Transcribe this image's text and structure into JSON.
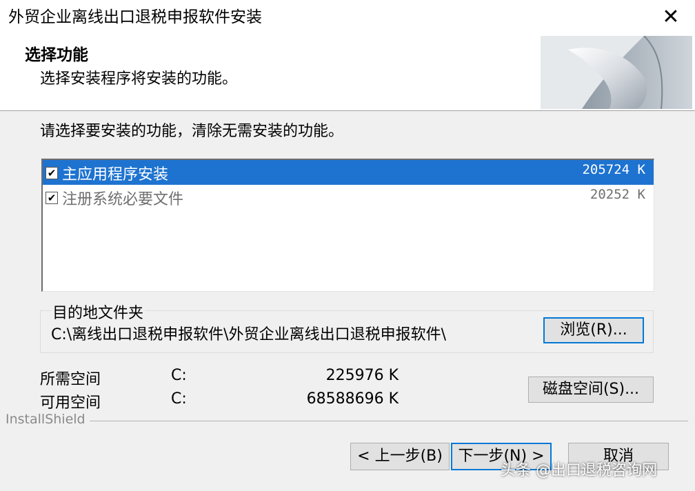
{
  "window": {
    "title": "外贸企业离线出口退税申报软件安装",
    "close_glyph": "✕"
  },
  "header": {
    "title": "选择功能",
    "subtitle": "选择安装程序将安装的功能。"
  },
  "instruction": "请选择要安装的功能，清除无需安装的功能。",
  "features": [
    {
      "name": "主应用程序安装",
      "size": "205724 K",
      "checked": true,
      "selected": true
    },
    {
      "name": "注册系统必要文件",
      "size": "20252 K",
      "checked": true,
      "selected": false
    }
  ],
  "checkmark": "✔",
  "destination": {
    "label": "目的地文件夹",
    "path": "C:\\离线出口退税申报软件\\外贸企业离线出口退税申报软件\\",
    "browse_label": "浏览(R)..."
  },
  "space": {
    "required": {
      "label": "所需空间",
      "drive": "C:",
      "value": "225976 K"
    },
    "available": {
      "label": "可用空间",
      "drive": "C:",
      "value": "68588696 K"
    },
    "disk_space_label": "磁盘空间(S)..."
  },
  "brand": "InstallShield",
  "nav": {
    "back_label": "< 上一步(B)",
    "next_label": "下一步(N) >",
    "cancel_label": "取消"
  },
  "watermark": "头条 @出口退税咨询网",
  "colors": {
    "selection": "#1e73d0",
    "focus_border": "#0078d7",
    "window_bg": "#f0f0f0"
  }
}
